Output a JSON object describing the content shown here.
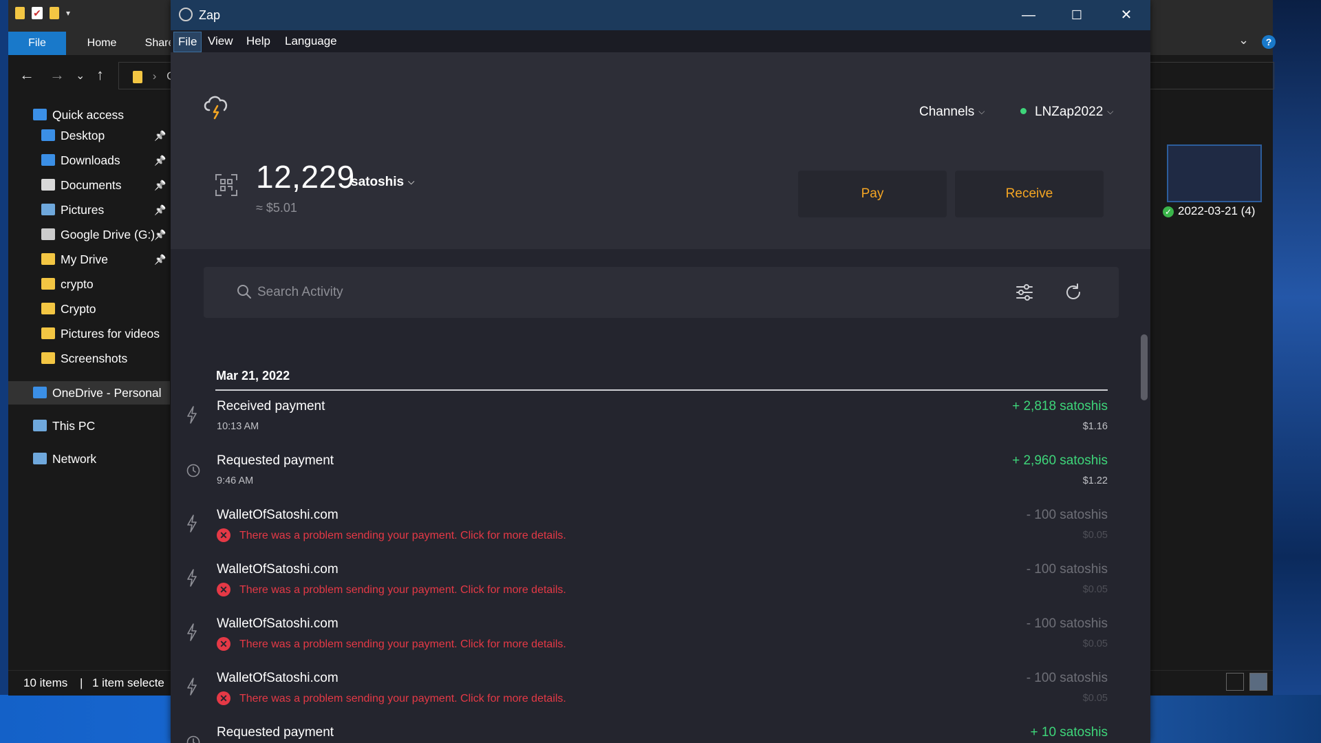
{
  "explorer": {
    "tabs": [
      "File",
      "Home",
      "Share"
    ],
    "address_partial": "Or",
    "sidebar": [
      {
        "label": "Quick access",
        "icon": "star-icon",
        "color": "#3b8fe6",
        "top": true
      },
      {
        "label": "Desktop",
        "icon": "desktop-icon",
        "color": "#3b8fe6",
        "pinned": true
      },
      {
        "label": "Downloads",
        "icon": "download-icon",
        "color": "#3b8fe6",
        "pinned": true
      },
      {
        "label": "Documents",
        "icon": "documents-icon",
        "color": "#d9d9d9",
        "pinned": true
      },
      {
        "label": "Pictures",
        "icon": "pictures-icon",
        "color": "#6fa8dc",
        "pinned": true
      },
      {
        "label": "Google Drive (G:)",
        "icon": "drive-icon",
        "color": "#cccccc",
        "pinned": true
      },
      {
        "label": "My Drive",
        "icon": "google-drive-icon",
        "color": "#f3c643",
        "pinned": true
      },
      {
        "label": "crypto",
        "icon": "folder-icon",
        "color": "#f3c643"
      },
      {
        "label": "Crypto",
        "icon": "folder-sync-icon",
        "color": "#f3c643"
      },
      {
        "label": "Pictures for videos",
        "icon": "folder-icon",
        "color": "#f3c643"
      },
      {
        "label": "Screenshots",
        "icon": "folder-icon",
        "color": "#f3c643"
      },
      {
        "label": "OneDrive - Personal",
        "icon": "onedrive-icon",
        "color": "#3b8fe6",
        "top": true,
        "selected": true
      },
      {
        "label": "This PC",
        "icon": "pc-icon",
        "color": "#6fa8dc",
        "top": true
      },
      {
        "label": "Network",
        "icon": "network-icon",
        "color": "#6fa8dc",
        "top": true
      }
    ],
    "status_items": "10 items",
    "status_selected": "1 item selecte",
    "thumbnail_label": "2022-03-21 (4)"
  },
  "zap": {
    "window_title": "Zap",
    "menu": [
      "File",
      "View",
      "Help",
      "Language"
    ],
    "channels_label": "Channels",
    "wallet_name": "LNZap2022",
    "balance": "12,229",
    "balance_unit": "satoshis",
    "balance_fiat": "≈ $5.01",
    "pay_label": "Pay",
    "receive_label": "Receive",
    "search_placeholder": "Search Activity",
    "date_header": "Mar 21, 2022",
    "activity": [
      {
        "name": "Received payment",
        "time": "10:13 AM",
        "amount": "+ 2,818 satoshis",
        "fiat": "$1.16",
        "kind": "received",
        "icon": "lightning-icon"
      },
      {
        "name": "Requested payment",
        "time": "9:46 AM",
        "amount": "+ 2,960 satoshis",
        "fiat": "$1.22",
        "kind": "received",
        "icon": "clock-icon"
      },
      {
        "name": "WalletOfSatoshi.com",
        "error": "There was a problem sending your payment. Click for more details.",
        "amount": "- 100 satoshis",
        "fiat": "$0.05",
        "kind": "failed",
        "icon": "lightning-icon"
      },
      {
        "name": "WalletOfSatoshi.com",
        "error": "There was a problem sending your payment. Click for more details.",
        "amount": "- 100 satoshis",
        "fiat": "$0.05",
        "kind": "failed",
        "icon": "lightning-icon"
      },
      {
        "name": "WalletOfSatoshi.com",
        "error": "There was a problem sending your payment. Click for more details.",
        "amount": "- 100 satoshis",
        "fiat": "$0.05",
        "kind": "failed",
        "icon": "lightning-icon"
      },
      {
        "name": "WalletOfSatoshi.com",
        "error": "There was a problem sending your payment. Click for more details.",
        "amount": "- 100 satoshis",
        "fiat": "$0.05",
        "kind": "failed",
        "icon": "lightning-icon"
      },
      {
        "name": "Requested payment",
        "amount": "+ 10 satoshis",
        "kind": "received",
        "icon": "clock-icon"
      }
    ],
    "colors": {
      "accent": "#f5a623",
      "positive": "#3ed67a",
      "error": "#e53946",
      "online": "#3ed67a"
    }
  }
}
